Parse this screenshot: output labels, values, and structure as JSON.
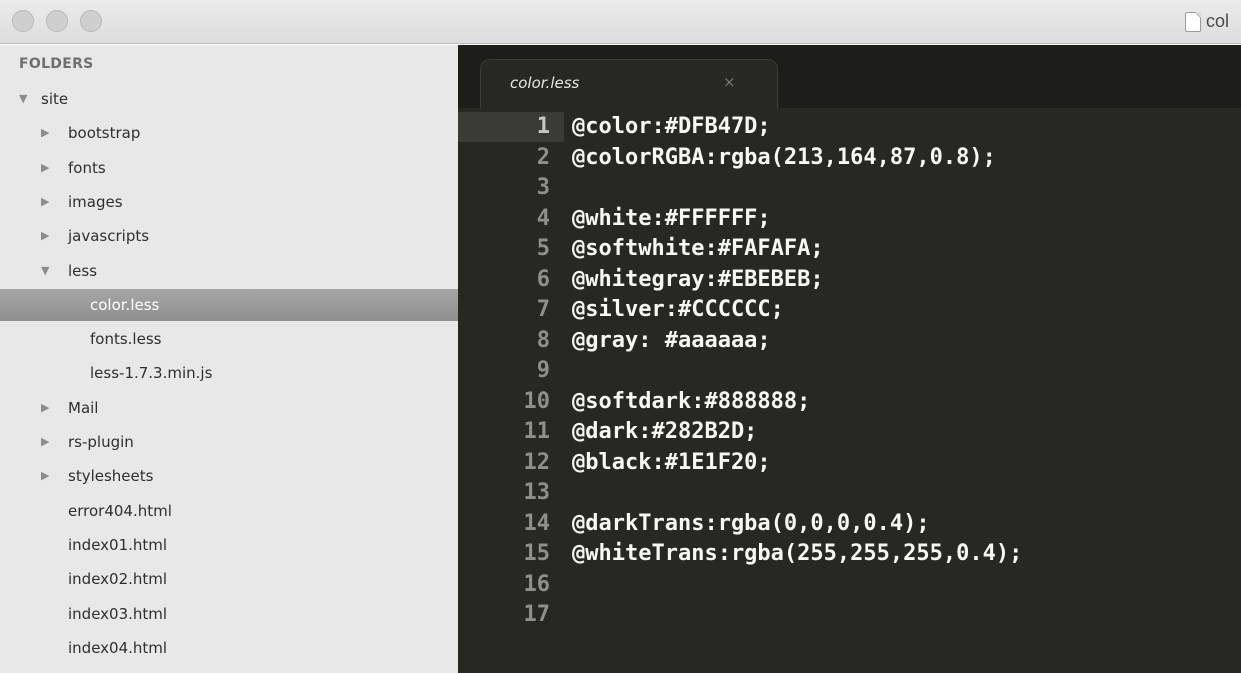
{
  "window": {
    "title": "col"
  },
  "sidebar": {
    "header": "FOLDERS",
    "items": [
      {
        "label": "site",
        "arrow": "▼",
        "indent": 0,
        "selected": false
      },
      {
        "label": "bootstrap",
        "arrow": "▶",
        "indent": 1,
        "selected": false
      },
      {
        "label": "fonts",
        "arrow": "▶",
        "indent": 1,
        "selected": false
      },
      {
        "label": "images",
        "arrow": "▶",
        "indent": 1,
        "selected": false
      },
      {
        "label": "javascripts",
        "arrow": "▶",
        "indent": 1,
        "selected": false
      },
      {
        "label": "less",
        "arrow": "▼",
        "indent": 1,
        "selected": false
      },
      {
        "label": "color.less",
        "arrow": "",
        "indent": 2,
        "selected": true
      },
      {
        "label": "fonts.less",
        "arrow": "",
        "indent": 2,
        "selected": false
      },
      {
        "label": "less-1.7.3.min.js",
        "arrow": "",
        "indent": 2,
        "selected": false
      },
      {
        "label": "Mail",
        "arrow": "▶",
        "indent": 1,
        "selected": false
      },
      {
        "label": "rs-plugin",
        "arrow": "▶",
        "indent": 1,
        "selected": false
      },
      {
        "label": "stylesheets",
        "arrow": "▶",
        "indent": 1,
        "selected": false
      },
      {
        "label": "error404.html",
        "arrow": "",
        "indent": 1,
        "selected": false
      },
      {
        "label": "index01.html",
        "arrow": "",
        "indent": 1,
        "selected": false
      },
      {
        "label": "index02.html",
        "arrow": "",
        "indent": 1,
        "selected": false
      },
      {
        "label": "index03.html",
        "arrow": "",
        "indent": 1,
        "selected": false
      },
      {
        "label": "index04.html",
        "arrow": "",
        "indent": 1,
        "selected": false
      }
    ]
  },
  "editor": {
    "tab": {
      "title": "color.less",
      "close": "×"
    },
    "current_line": 1,
    "lines": [
      {
        "n": "1",
        "text": "@color:#DFB47D;"
      },
      {
        "n": "2",
        "text": "@colorRGBA:rgba(213,164,87,0.8);"
      },
      {
        "n": "3",
        "text": ""
      },
      {
        "n": "4",
        "text": "@white:#FFFFFF;"
      },
      {
        "n": "5",
        "text": "@softwhite:#FAFAFA;"
      },
      {
        "n": "6",
        "text": "@whitegray:#EBEBEB;"
      },
      {
        "n": "7",
        "text": "@silver:#CCCCCC;"
      },
      {
        "n": "8",
        "text": "@gray: #aaaaaa;"
      },
      {
        "n": "9",
        "text": ""
      },
      {
        "n": "10",
        "text": "@softdark:#888888;"
      },
      {
        "n": "11",
        "text": "@dark:#282B2D;"
      },
      {
        "n": "12",
        "text": "@black:#1E1F20;"
      },
      {
        "n": "13",
        "text": ""
      },
      {
        "n": "14",
        "text": "@darkTrans:rgba(0,0,0,0.4);"
      },
      {
        "n": "15",
        "text": "@whiteTrans:rgba(255,255,255,0.4);"
      },
      {
        "n": "16",
        "text": ""
      },
      {
        "n": "17",
        "text": ""
      }
    ]
  },
  "colors": {
    "editor_bg": "#272822",
    "sidebar_bg": "#e8e8e8",
    "selection": "#999999"
  }
}
